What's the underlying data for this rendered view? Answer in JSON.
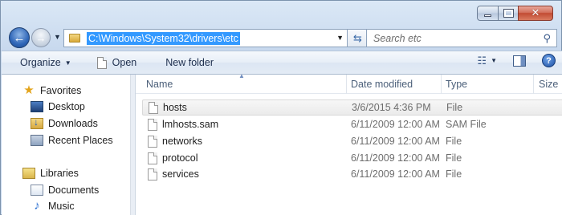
{
  "window": {
    "caption_buttons": [
      "minimize-icon",
      "maximize-icon",
      "close-icon"
    ]
  },
  "address_bar": {
    "path": "C:\\Windows\\System32\\drivers\\etc",
    "refresh_icon": "refresh-icon"
  },
  "search": {
    "placeholder": "Search etc"
  },
  "toolbar": {
    "organize_label": "Organize",
    "open_label": "Open",
    "new_folder_label": "New folder"
  },
  "sidebar": {
    "favorites_label": "Favorites",
    "items": [
      {
        "label": "Desktop"
      },
      {
        "label": "Downloads"
      },
      {
        "label": "Recent Places"
      }
    ],
    "libraries_label": "Libraries",
    "library_items": [
      {
        "label": "Documents"
      },
      {
        "label": "Music"
      }
    ]
  },
  "file_list": {
    "columns": [
      "Name",
      "Date modified",
      "Type",
      "Size"
    ],
    "rows": [
      {
        "name": "hosts",
        "date": "3/6/2015 4:36 PM",
        "type": "File"
      },
      {
        "name": "lmhosts.sam",
        "date": "6/11/2009 12:00 AM",
        "type": "SAM File"
      },
      {
        "name": "networks",
        "date": "6/11/2009 12:00 AM",
        "type": "File"
      },
      {
        "name": "protocol",
        "date": "6/11/2009 12:00 AM",
        "type": "File"
      },
      {
        "name": "services",
        "date": "6/11/2009 12:00 AM",
        "type": "File"
      }
    ]
  },
  "colors": {
    "selection": "#3399ff",
    "window_frame": "#c8d9ee"
  }
}
